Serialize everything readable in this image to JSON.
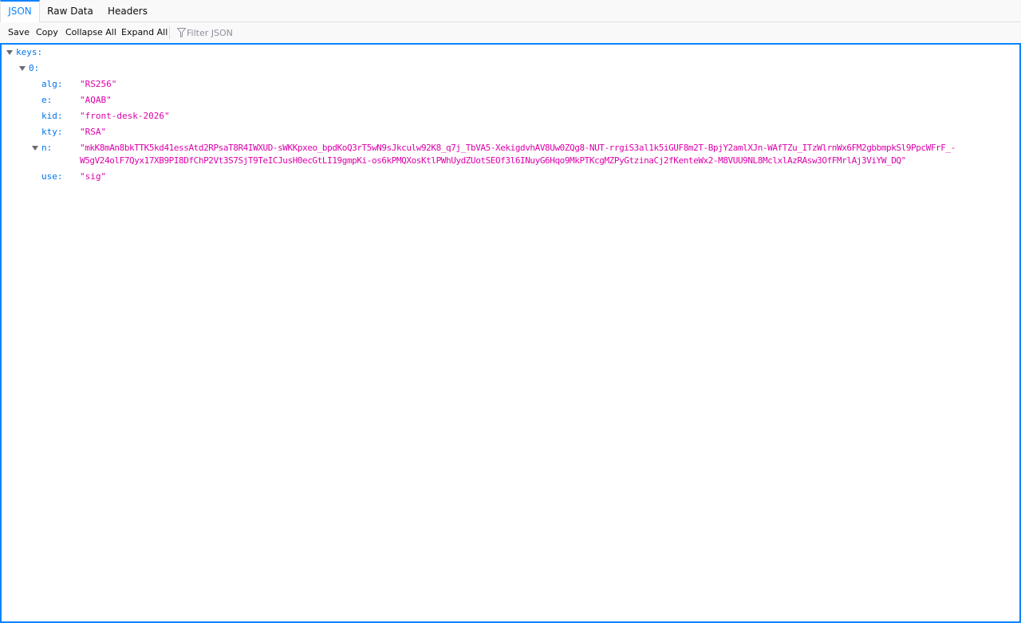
{
  "tabs": [
    {
      "label": "JSON",
      "selected": true
    },
    {
      "label": "Raw Data",
      "selected": false
    },
    {
      "label": "Headers",
      "selected": false
    }
  ],
  "toolbar": {
    "save": "Save",
    "copy": "Copy",
    "collapse_all": "Collapse All",
    "expand_all": "Expand All",
    "filter_placeholder": "Filter JSON",
    "filter_value": ""
  },
  "tree": {
    "root_key": "keys:",
    "item_key": "0:",
    "fields": {
      "alg": {
        "key": "alg:",
        "value": "\"RS256\""
      },
      "e": {
        "key": "e:",
        "value": "\"AQAB\""
      },
      "kid": {
        "key": "kid:",
        "value": "\"front-desk-2026\""
      },
      "kty": {
        "key": "kty:",
        "value": "\"RSA\""
      },
      "n": {
        "key": "n:",
        "value_line1": "\"mkK8mAn8bkTTK5kd41essAtd2RPsaT8R4IWXUD-sWKKpxeo_bpdKoQ3rT5wN9sJkculw92K8_q7j_TbVA5-XekigdvhAV8Uw0ZQg8-NUT-rrgiS3al1k5iGUF8m2T-BpjY2amlXJn-WAfTZu_ITzWlrnWx6FM2gbbmpkSl9PpcWFrF_-",
        "value_line2": "W5gV24olF7Qyx17XB9PI8DfChP2Vt3S7SjT9TeICJusH0ecGtLI19gmpKi-os6kPMQXosKtlPWhUydZUotSEOf3l6INuyG6Hqo9MkPTKcgMZPyGtzinaCj2fKenteWx2-M8VUU9NL8MclxlAzRAsw3OfFMrlAj3ViYW_DQ\""
      },
      "use": {
        "key": "use:",
        "value": "\"sig\""
      }
    }
  },
  "colors": {
    "accent": "#0a84ff",
    "key": "#0074e8",
    "string": "#dd00a9"
  },
  "icons": {
    "filter": "filter-icon",
    "expand_toggle": "chevron-down-icon"
  }
}
